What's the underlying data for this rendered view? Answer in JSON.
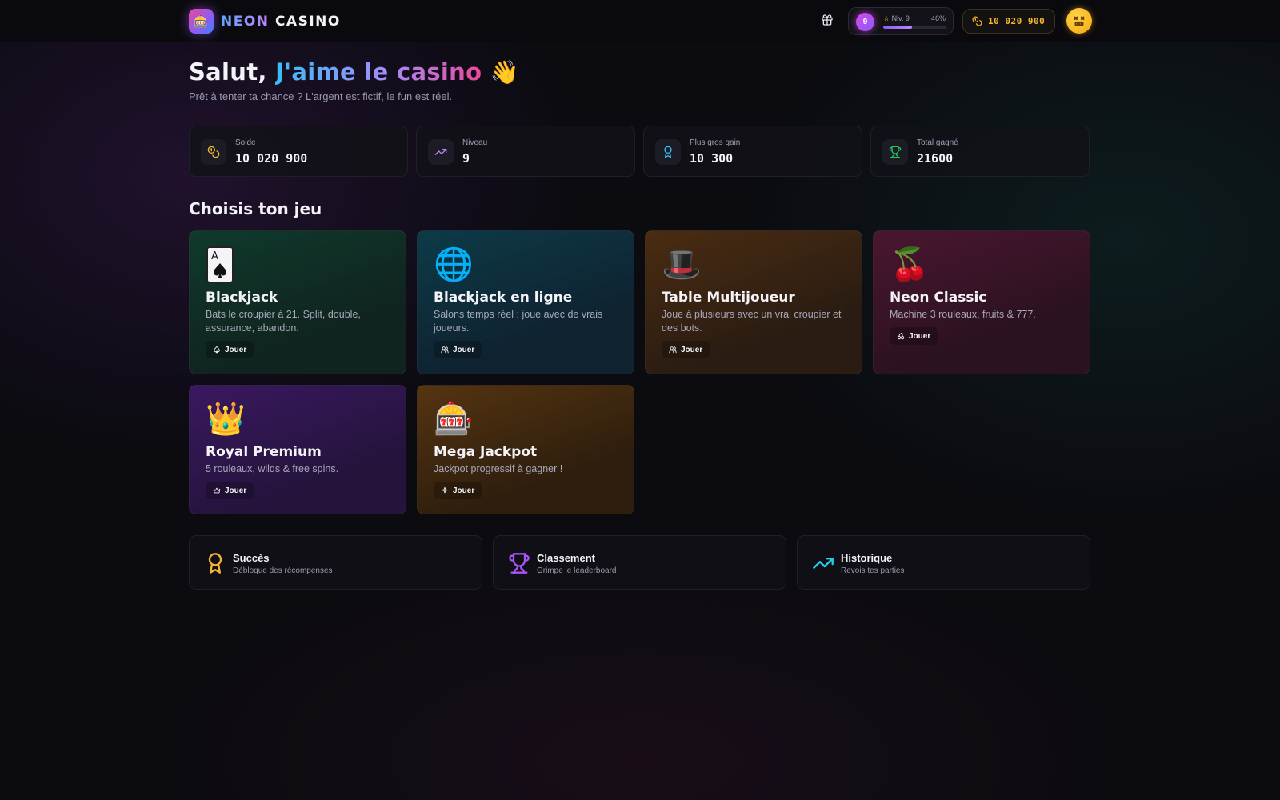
{
  "header": {
    "logo_emoji": "🎰",
    "logo_neon": "NEON",
    "logo_casino": "CASINO",
    "level_number": "9",
    "level_label": "Niv. 9",
    "level_percent_label": "46%",
    "level_progress": 0.46,
    "balance": "10 020 900",
    "icons": {
      "gift": "gift-icon",
      "coins": "coins-icon",
      "star": "star-icon",
      "avatar": "dizzy-face-avatar"
    }
  },
  "hero": {
    "greeting_prefix": "Salut, ",
    "greeting_name": "J'aime le casino",
    "greeting_emoji": "👋",
    "subtitle": "Prêt à tenter ta chance ? L'argent est fictif, le fun est réel."
  },
  "stats": [
    {
      "label": "Solde",
      "value": "10 020 900",
      "icon": "coins-icon",
      "color": "#f5b731"
    },
    {
      "label": "Niveau",
      "value": "9",
      "icon": "trending-up-icon",
      "color": "#c084fc"
    },
    {
      "label": "Plus gros gain",
      "value": "10 300",
      "icon": "award-icon",
      "color": "#38bdf8"
    },
    {
      "label": "Total gagné",
      "value": "21600",
      "icon": "trophy-icon",
      "color": "#22c55e"
    }
  ],
  "games_section_title": "Choisis ton jeu",
  "games": [
    {
      "emoji": "🂡",
      "title": "Blackjack",
      "desc": "Bats le croupier à 21. Split, double, assurance, abandon.",
      "play": "Jouer",
      "icon": "spade-icon"
    },
    {
      "emoji": "🌐",
      "title": "Blackjack en ligne",
      "desc": "Salons temps réel : joue avec de vrais joueurs.",
      "play": "Jouer",
      "icon": "users-icon"
    },
    {
      "emoji": "🎩",
      "title": "Table Multijoueur",
      "desc": "Joue à plusieurs avec un vrai croupier et des bots.",
      "play": "Jouer",
      "icon": "users-icon"
    },
    {
      "emoji": "🍒",
      "title": "Neon Classic",
      "desc": "Machine 3 rouleaux, fruits & 777.",
      "play": "Jouer",
      "icon": "cherry-icon"
    },
    {
      "emoji": "👑",
      "title": "Royal Premium",
      "desc": "5 rouleaux, wilds & free spins.",
      "play": "Jouer",
      "icon": "crown-icon"
    },
    {
      "emoji": "🎰",
      "title": "Mega Jackpot",
      "desc": "Jackpot progressif à gagner !",
      "play": "Jouer",
      "icon": "sparkles-icon"
    }
  ],
  "links": [
    {
      "title": "Succès",
      "sub": "Débloque des récompenses",
      "icon": "award-icon",
      "color": "#f5b731"
    },
    {
      "title": "Classement",
      "sub": "Grimpe le leaderboard",
      "icon": "trophy-icon",
      "color": "#a855f7"
    },
    {
      "title": "Historique",
      "sub": "Revois tes parties",
      "icon": "trending-up-icon",
      "color": "#22d3ee"
    }
  ]
}
